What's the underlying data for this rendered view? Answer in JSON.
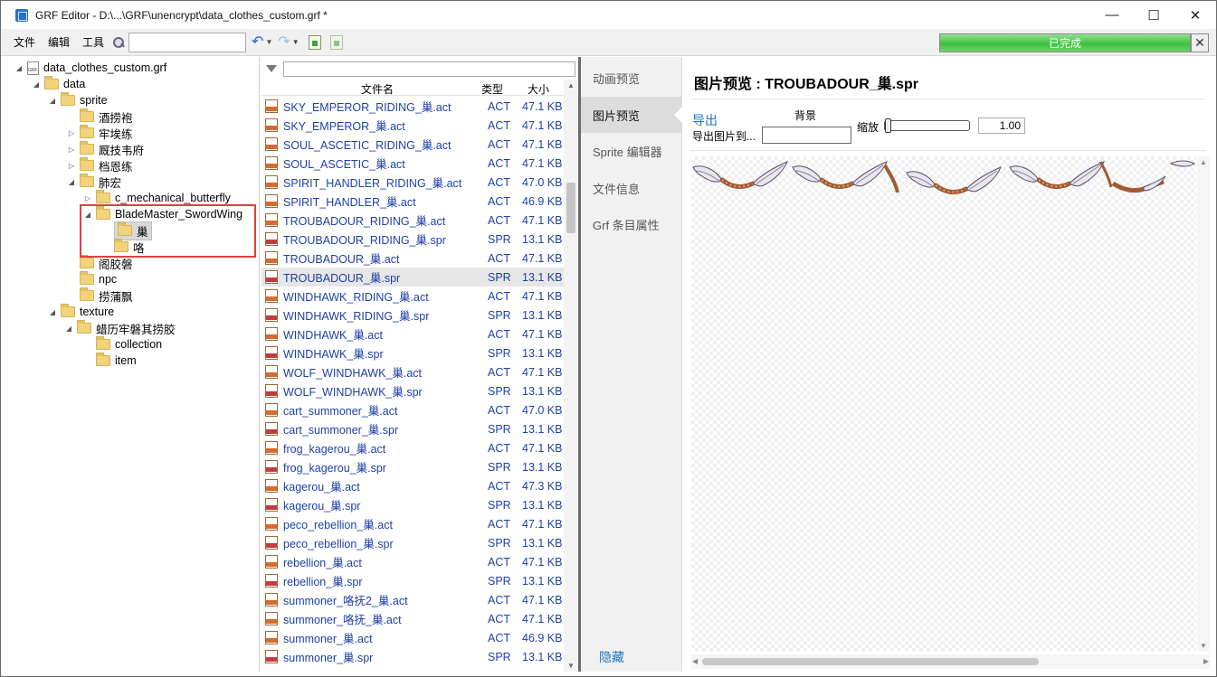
{
  "window": {
    "title": "GRF Editor - D:\\...\\GRF\\unencrypt\\data_clothes_custom.grf *",
    "controls": [
      "—",
      "☐",
      "✕"
    ]
  },
  "menu": {
    "items": [
      "文件",
      "编辑",
      "工具"
    ]
  },
  "toolbar": {
    "search_value": "",
    "undo_icon": "undo-icon",
    "redo_icon": "redo-icon"
  },
  "progress": {
    "label": "已完成",
    "value_percent": 100,
    "close": "✕"
  },
  "tree": {
    "nodes": [
      {
        "label": "data_clothes_custom.grf",
        "twisty": "◢",
        "icon": "grf-file-icon"
      },
      {
        "label": "data",
        "twisty": "◢",
        "icon": "folder-icon"
      },
      {
        "label": "sprite",
        "twisty": "◢",
        "icon": "folder-icon"
      },
      {
        "label": "酒捞袍",
        "twisty": "",
        "icon": "folder-icon"
      },
      {
        "label": "牢埃练",
        "twisty": "▷",
        "icon": "folder-icon"
      },
      {
        "label": "厩技韦府",
        "twisty": "▷",
        "icon": "folder-icon"
      },
      {
        "label": "档恩练",
        "twisty": "▷",
        "icon": "folder-icon"
      },
      {
        "label": "肺宏",
        "twisty": "◢",
        "icon": "folder-icon"
      },
      {
        "label": "c_mechanical_butterfly",
        "twisty": "▷",
        "icon": "folder-icon"
      },
      {
        "label": "BladeMaster_SwordWing",
        "twisty": "◢",
        "icon": "folder-icon"
      },
      {
        "label": "巢",
        "twisty": "",
        "icon": "folder-icon",
        "selected": true
      },
      {
        "label": "咯",
        "twisty": "",
        "icon": "folder-icon"
      },
      {
        "label": "阁胶磐",
        "twisty": "",
        "icon": "folder-icon"
      },
      {
        "label": "npc",
        "twisty": "",
        "icon": "folder-icon"
      },
      {
        "label": "捞蒲飘",
        "twisty": "",
        "icon": "folder-icon"
      },
      {
        "label": "texture",
        "twisty": "◢",
        "icon": "folder-icon"
      },
      {
        "label": "蜡历牢磐其捞胶",
        "twisty": "◢",
        "icon": "folder-icon"
      },
      {
        "label": "collection",
        "twisty": "",
        "icon": "folder-icon"
      },
      {
        "label": "item",
        "twisty": "",
        "icon": "folder-icon"
      }
    ]
  },
  "filelist": {
    "filter_value": "",
    "headers": {
      "name": "文件名",
      "type": "类型",
      "size": "大小"
    },
    "rows": [
      {
        "name": "SKY_EMPEROR_RIDING_巢.act",
        "type": "ACT",
        "size": "47.1 KB"
      },
      {
        "name": "SKY_EMPEROR_巢.act",
        "type": "ACT",
        "size": "47.1 KB"
      },
      {
        "name": "SOUL_ASCETIC_RIDING_巢.act",
        "type": "ACT",
        "size": "47.1 KB"
      },
      {
        "name": "SOUL_ASCETIC_巢.act",
        "type": "ACT",
        "size": "47.1 KB"
      },
      {
        "name": "SPIRIT_HANDLER_RIDING_巢.act",
        "type": "ACT",
        "size": "47.0 KB"
      },
      {
        "name": "SPIRIT_HANDLER_巢.act",
        "type": "ACT",
        "size": "46.9 KB"
      },
      {
        "name": "TROUBADOUR_RIDING_巢.act",
        "type": "ACT",
        "size": "47.1 KB"
      },
      {
        "name": "TROUBADOUR_RIDING_巢.spr",
        "type": "SPR",
        "size": "13.1 KB"
      },
      {
        "name": "TROUBADOUR_巢.act",
        "type": "ACT",
        "size": "47.1 KB"
      },
      {
        "name": "TROUBADOUR_巢.spr",
        "type": "SPR",
        "size": "13.1 KB",
        "selected": true
      },
      {
        "name": "WINDHAWK_RIDING_巢.act",
        "type": "ACT",
        "size": "47.1 KB"
      },
      {
        "name": "WINDHAWK_RIDING_巢.spr",
        "type": "SPR",
        "size": "13.1 KB"
      },
      {
        "name": "WINDHAWK_巢.act",
        "type": "ACT",
        "size": "47.1 KB"
      },
      {
        "name": "WINDHAWK_巢.spr",
        "type": "SPR",
        "size": "13.1 KB"
      },
      {
        "name": "WOLF_WINDHAWK_巢.act",
        "type": "ACT",
        "size": "47.1 KB"
      },
      {
        "name": "WOLF_WINDHAWK_巢.spr",
        "type": "SPR",
        "size": "13.1 KB"
      },
      {
        "name": "cart_summoner_巢.act",
        "type": "ACT",
        "size": "47.0 KB"
      },
      {
        "name": "cart_summoner_巢.spr",
        "type": "SPR",
        "size": "13.1 KB"
      },
      {
        "name": "frog_kagerou_巢.act",
        "type": "ACT",
        "size": "47.1 KB"
      },
      {
        "name": "frog_kagerou_巢.spr",
        "type": "SPR",
        "size": "13.1 KB"
      },
      {
        "name": "kagerou_巢.act",
        "type": "ACT",
        "size": "47.3 KB"
      },
      {
        "name": "kagerou_巢.spr",
        "type": "SPR",
        "size": "13.1 KB"
      },
      {
        "name": "peco_rebellion_巢.act",
        "type": "ACT",
        "size": "47.1 KB"
      },
      {
        "name": "peco_rebellion_巢.spr",
        "type": "SPR",
        "size": "13.1 KB"
      },
      {
        "name": "rebellion_巢.act",
        "type": "ACT",
        "size": "47.1 KB"
      },
      {
        "name": "rebellion_巢.spr",
        "type": "SPR",
        "size": "13.1 KB"
      },
      {
        "name": "summoner_咯抚2_巢.act",
        "type": "ACT",
        "size": "47.1 KB"
      },
      {
        "name": "summoner_咯抚_巢.act",
        "type": "ACT",
        "size": "47.1 KB"
      },
      {
        "name": "summoner_巢.act",
        "type": "ACT",
        "size": "46.9 KB"
      },
      {
        "name": "summoner_巢.spr",
        "type": "SPR",
        "size": "13.1 KB"
      }
    ]
  },
  "sidetabs": {
    "items": [
      "动画预览",
      "图片预览",
      "Sprite 编辑器",
      "文件信息",
      "Grf 条目属性"
    ],
    "active_index": 1,
    "hide_label": "隐藏"
  },
  "preview": {
    "title": "图片预览 : TROUBADOUR_巢.spr",
    "export_label": "导出",
    "export_to_label": "导出图片到...",
    "background_label": "背景",
    "zoom_label": "缩放",
    "zoom_value": "1.00",
    "zoom_slider_fraction": 0
  },
  "colors": {
    "link_blue": "#1d3fa8",
    "accent_blue": "#1e74c0",
    "progress_green": "#3fbf3f",
    "highlight_red": "#e04040"
  }
}
